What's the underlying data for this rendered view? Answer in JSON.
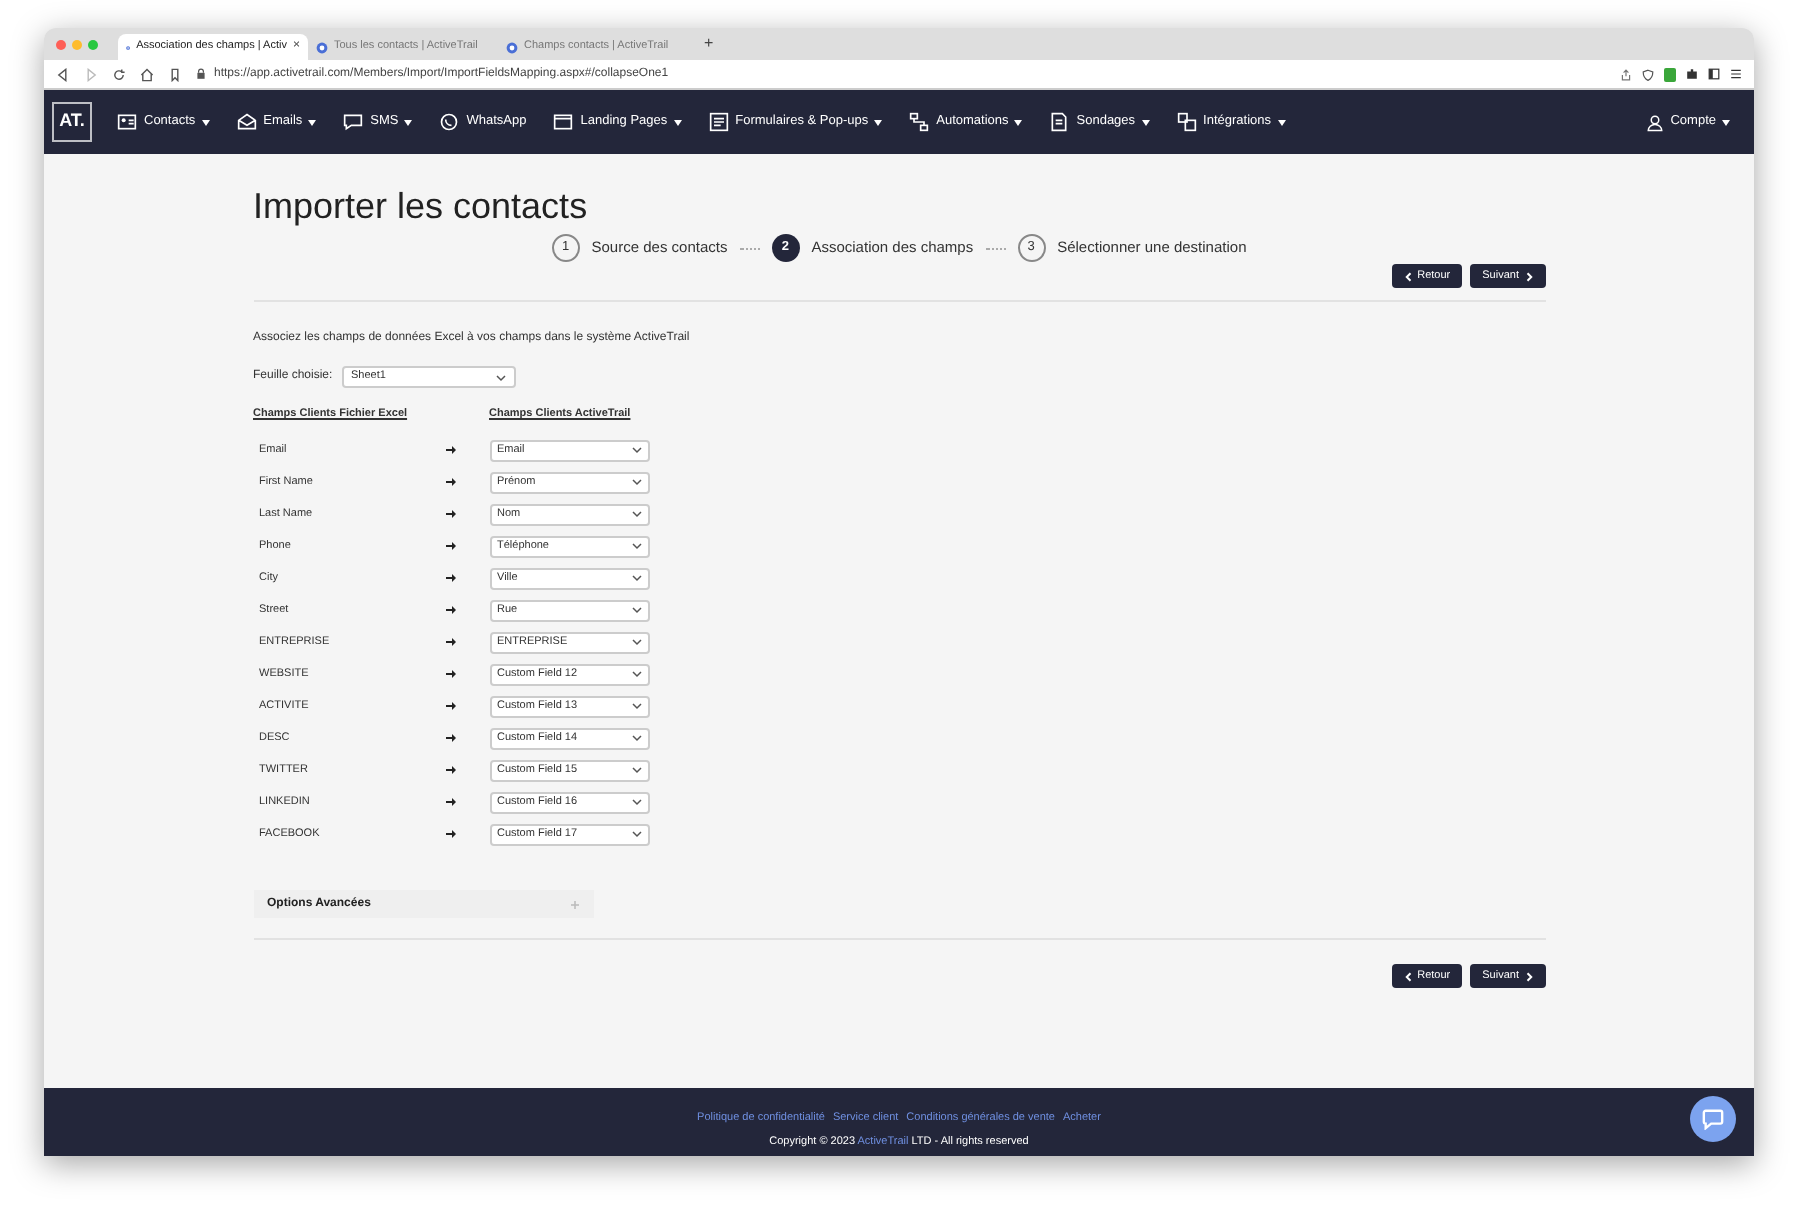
{
  "browser": {
    "tabs": [
      {
        "title": "Association des champs | Activ",
        "selected": true
      },
      {
        "title": "Tous les contacts | ActiveTrail",
        "selected": false
      },
      {
        "title": "Champs contacts | ActiveTrail",
        "selected": false
      }
    ],
    "close_tab": "×",
    "new_tab": "+",
    "url": "https://app.activetrail.com/Members/Import/ImportFieldsMapping.aspx#/collapseOne1"
  },
  "nav": {
    "logo": "AT.",
    "items": [
      {
        "label": "Contacts",
        "kind": "contacts",
        "dropdown": true
      },
      {
        "label": "Emails",
        "kind": "emails",
        "dropdown": true
      },
      {
        "label": "SMS",
        "kind": "sms",
        "dropdown": true
      },
      {
        "label": "WhatsApp",
        "kind": "whatsapp",
        "dropdown": false
      },
      {
        "label": "Landing Pages",
        "kind": "landing",
        "dropdown": true
      },
      {
        "label": "Formulaires & Pop-ups",
        "kind": "forms",
        "dropdown": true
      },
      {
        "label": "Automations",
        "kind": "automations",
        "dropdown": true
      },
      {
        "label": "Sondages",
        "kind": "surveys",
        "dropdown": true
      },
      {
        "label": "Intégrations",
        "kind": "integrations",
        "dropdown": true
      }
    ],
    "account": {
      "label": "Compte",
      "dropdown": true
    }
  },
  "page": {
    "title": "Importer les contacts",
    "steps": [
      {
        "number": "1",
        "label": "Source des contacts",
        "selected": false
      },
      {
        "number": "2",
        "label": "Association des champs",
        "selected": true
      },
      {
        "number": "3",
        "label": "Sélectionner une destination",
        "selected": false
      }
    ],
    "buttons": [
      {
        "label": "Retour",
        "kind": "back"
      },
      {
        "label": "Suivant",
        "kind": "next"
      }
    ],
    "instruction": "Associez les champs de données Excel à vos champs dans le système ActiveTrail",
    "sheet": {
      "label": "Feuille choisie:",
      "value": "Sheet1"
    },
    "columns": [
      "Champs Clients Fichier Excel",
      "Champs Clients ActiveTrail"
    ],
    "mappings": [
      {
        "source": "Email",
        "target": "Email"
      },
      {
        "source": "First Name",
        "target": "Prénom"
      },
      {
        "source": "Last Name",
        "target": "Nom"
      },
      {
        "source": "Phone",
        "target": "Téléphone"
      },
      {
        "source": "City",
        "target": "Ville"
      },
      {
        "source": "Street",
        "target": "Rue"
      },
      {
        "source": "ENTREPRISE",
        "target": "ENTREPRISE"
      },
      {
        "source": "WEBSITE",
        "target": "Custom Field 12"
      },
      {
        "source": "ACTIVITE",
        "target": "Custom Field 13"
      },
      {
        "source": "DESC",
        "target": "Custom Field 14"
      },
      {
        "source": "TWITTER",
        "target": "Custom Field 15"
      },
      {
        "source": "LINKEDIN",
        "target": "Custom Field 16"
      },
      {
        "source": "FACEBOOK",
        "target": "Custom Field 17"
      }
    ],
    "advanced": {
      "label": "Options Avancées",
      "expanded": false
    },
    "bottom_buttons": [
      {
        "label": "Retour",
        "kind": "back"
      },
      {
        "label": "Suivant",
        "kind": "next"
      }
    ]
  },
  "footer": {
    "links": [
      "Politique de confidentialité",
      "Service client",
      "Conditions générales de vente",
      "Acheter"
    ],
    "copyright": {
      "before": "Copyright © 2023 ",
      "link": "ActiveTrail",
      "after": " LTD - All rights reserved"
    }
  }
}
